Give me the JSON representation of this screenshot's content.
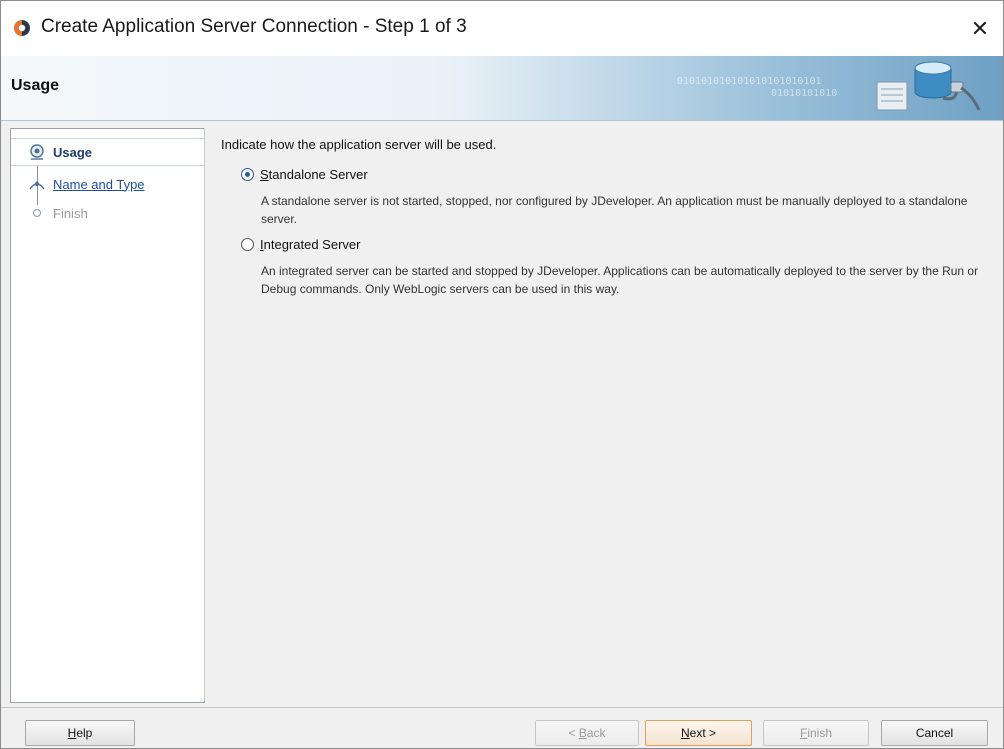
{
  "window": {
    "title": "Create Application Server Connection - Step 1 of 3",
    "close_glyph": "✕",
    "icon": "oracle-app-icon"
  },
  "header": {
    "title": "Usage",
    "binary_text": "010101010101010101010101",
    "binary_text2": "01010101010"
  },
  "nav": {
    "items": [
      {
        "label": "Usage",
        "state": "current"
      },
      {
        "label": "Name and Type",
        "state": "link"
      },
      {
        "label": "Finish",
        "state": "disabled"
      }
    ]
  },
  "content": {
    "prompt": "Indicate how  the application server will be used.",
    "options": [
      {
        "label": "Standalone Server",
        "mnemonic": "S",
        "rest": "tandalone Server",
        "checked": true,
        "description": "A standalone server is not started, stopped, nor configured by JDeveloper. An application must be manually deployed to a standalone server."
      },
      {
        "label": "Integrated Server",
        "mnemonic": "I",
        "rest": "ntegrated Server",
        "checked": false,
        "description": "An integrated server can be started and stopped by JDeveloper. Applications can be automatically deployed to the server by the Run or Debug commands. Only WebLogic servers can be used in this way."
      }
    ]
  },
  "buttons": {
    "help": {
      "mn": "H",
      "rest": "elp"
    },
    "back": {
      "pre": "< ",
      "mn": "B",
      "rest": "ack"
    },
    "next": {
      "mn": "N",
      "rest": "ext >"
    },
    "finish": {
      "mn": "F",
      "rest": "inish"
    },
    "cancel": "Cancel"
  }
}
